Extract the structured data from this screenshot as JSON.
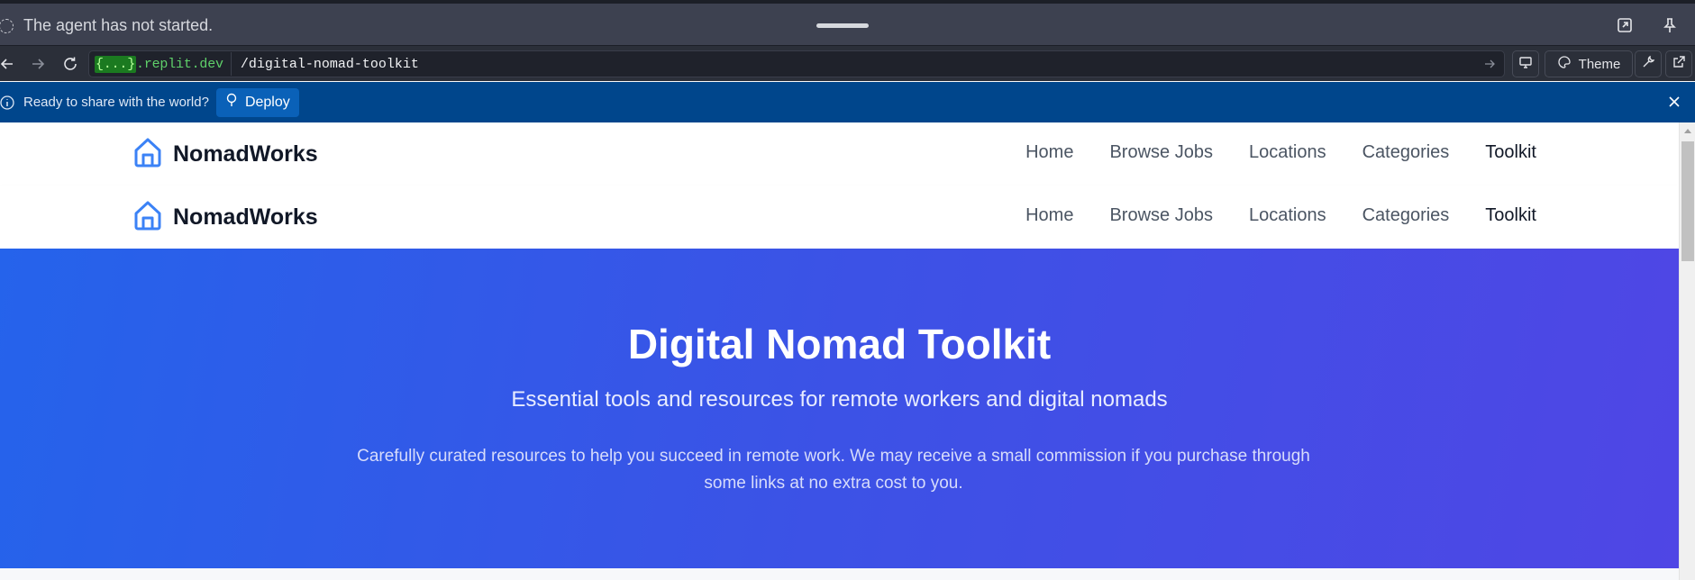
{
  "agent_bar": {
    "status": "The agent has not started."
  },
  "browser": {
    "host_highlight": "{...}",
    "host_domain": ".replit.dev",
    "path": "/digital-nomad-toolkit",
    "theme_label": "Theme"
  },
  "banner": {
    "message": "Ready to share with the world?",
    "deploy_label": "Deploy"
  },
  "site": {
    "brand": "NomadWorks",
    "nav": [
      "Home",
      "Browse Jobs",
      "Locations",
      "Categories",
      "Toolkit"
    ],
    "active_nav": "Toolkit"
  },
  "hero": {
    "title": "Digital Nomad Toolkit",
    "subtitle": "Essential tools and resources for remote workers and digital nomads",
    "description_line1": "Carefully curated resources to help you succeed in remote work. We may receive a small commission if you purchase through",
    "description_line2": "some links at no extra cost to you."
  },
  "colors": {
    "hero_gradient_start": "#2563eb",
    "hero_gradient_end": "#4f46e5",
    "banner_bg": "#00468c",
    "brand_icon": "#3b82f6"
  }
}
